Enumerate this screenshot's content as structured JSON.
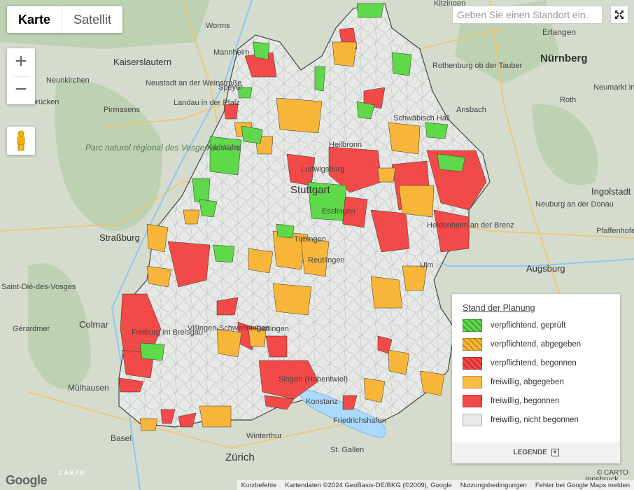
{
  "map_type": {
    "map_label": "Karte",
    "satellite_label": "Satellit"
  },
  "search": {
    "placeholder": "Geben Sie einen Standort ein."
  },
  "zoom": {
    "in_label": "+",
    "out_label": "−"
  },
  "colors": {
    "background_land": "#d7ddcf",
    "forest": "#bcd3b3",
    "state_fill": "#e6e9e5",
    "state_border": "#3a3a3a",
    "water": "#aadaff",
    "verpflichtend_geprueft": "#5fd84a",
    "verpflichtend_abgegeben": "#f7b63a",
    "verpflichtend_begonnen": "#f24a48",
    "freiwillig_abgegeben": "#fbbd47",
    "freiwillig_begonnen": "#f24a48",
    "freiwillig_nicht_begonnen": "#e9e9e9"
  },
  "places": [
    {
      "name": "Erlangen"
    },
    {
      "name": "Nürnberg"
    },
    {
      "name": "Worms"
    },
    {
      "name": "Mannheim"
    },
    {
      "name": "Kaiserslautern"
    },
    {
      "name": "Neunkirchen"
    },
    {
      "name": "Neustadt an der Weinstraße"
    },
    {
      "name": "Saarbrücken"
    },
    {
      "name": "Pirmasens"
    },
    {
      "name": "Landau in der Pfalz"
    },
    {
      "name": "Speyer"
    },
    {
      "name": "Karlsruhe"
    },
    {
      "name": "Parc naturel régional des Vosges du Nord"
    },
    {
      "name": "Heilbronn"
    },
    {
      "name": "Ludwigsburg"
    },
    {
      "name": "Stuttgart"
    },
    {
      "name": "Esslingen"
    },
    {
      "name": "Tübingen"
    },
    {
      "name": "Reutlingen"
    },
    {
      "name": "Schwäbisch Hall"
    },
    {
      "name": "Rothenburg ob der Tauber"
    },
    {
      "name": "Ansbach"
    },
    {
      "name": "Neumarkt in der Oberpfalz"
    },
    {
      "name": "Roth"
    },
    {
      "name": "Ingolstadt"
    },
    {
      "name": "Neuburg an der Donau"
    },
    {
      "name": "Pfaffenhofen an der Ilm"
    },
    {
      "name": "Augsburg"
    },
    {
      "name": "Heidenheim an der Brenz"
    },
    {
      "name": "Ulm"
    },
    {
      "name": "Straßburg"
    },
    {
      "name": "Saint-Dié-des-Vosges"
    },
    {
      "name": "Colmar"
    },
    {
      "name": "Gérardmer"
    },
    {
      "name": "Freiburg im Breisgau"
    },
    {
      "name": "Mülhausen"
    },
    {
      "name": "Basel"
    },
    {
      "name": "Villingen-Schwenningen"
    },
    {
      "name": "Tuttlingen"
    },
    {
      "name": "Singen (Hohentwiel)"
    },
    {
      "name": "Konstanz"
    },
    {
      "name": "Friedrichshafen"
    },
    {
      "name": "Winterthur"
    },
    {
      "name": "Zürich"
    },
    {
      "name": "St. Gallen"
    },
    {
      "name": "Innsbruck"
    },
    {
      "name": "Kitzingen"
    }
  ],
  "legend": {
    "title": "Stand der Planung",
    "items": [
      {
        "label": "verpflichtend, geprüft",
        "color": "#5fd84a",
        "hatched": true
      },
      {
        "label": "verpflichtend, abgegeben",
        "color": "#f7b63a",
        "hatched": true
      },
      {
        "label": "verpflichtend, begonnen",
        "color": "#f24a48",
        "hatched": true
      },
      {
        "label": "freiwillig, abgegeben",
        "color": "#fbbd47",
        "hatched": false
      },
      {
        "label": "freiwillig, begonnen",
        "color": "#f24a48",
        "hatched": false
      },
      {
        "label": "freiwillig, nicht begonnen",
        "color": "#e9e9e9",
        "hatched": false
      }
    ],
    "footer": "LEGENDE"
  },
  "attribution": {
    "shortcuts": "Kurzbefehle",
    "data": "Kartendaten ©2024 GeoBasis-DE/BKG (©2009), Google",
    "terms": "Nutzungsbedingungen",
    "report": "Fehler bei Google Maps melden",
    "carto": "© CARTO",
    "google_logo": "Google",
    "carto_logo": "CARTO"
  }
}
